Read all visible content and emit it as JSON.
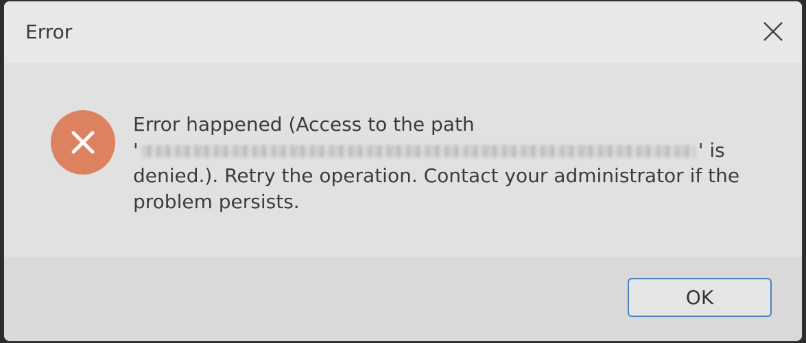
{
  "window": {
    "title": "Error",
    "close_icon": "close-icon"
  },
  "message": {
    "icon": "error-x-icon",
    "icon_color": "#dd8260",
    "text_before": "Error happened (Access to the path",
    "quote_open": "'",
    "quote_close": "'",
    "text_after_path": "is denied.). Retry the operation. Contact your administrator if the problem persists."
  },
  "buttons": {
    "ok_label": "OK",
    "ok_border_color": "#4a7fc2"
  }
}
